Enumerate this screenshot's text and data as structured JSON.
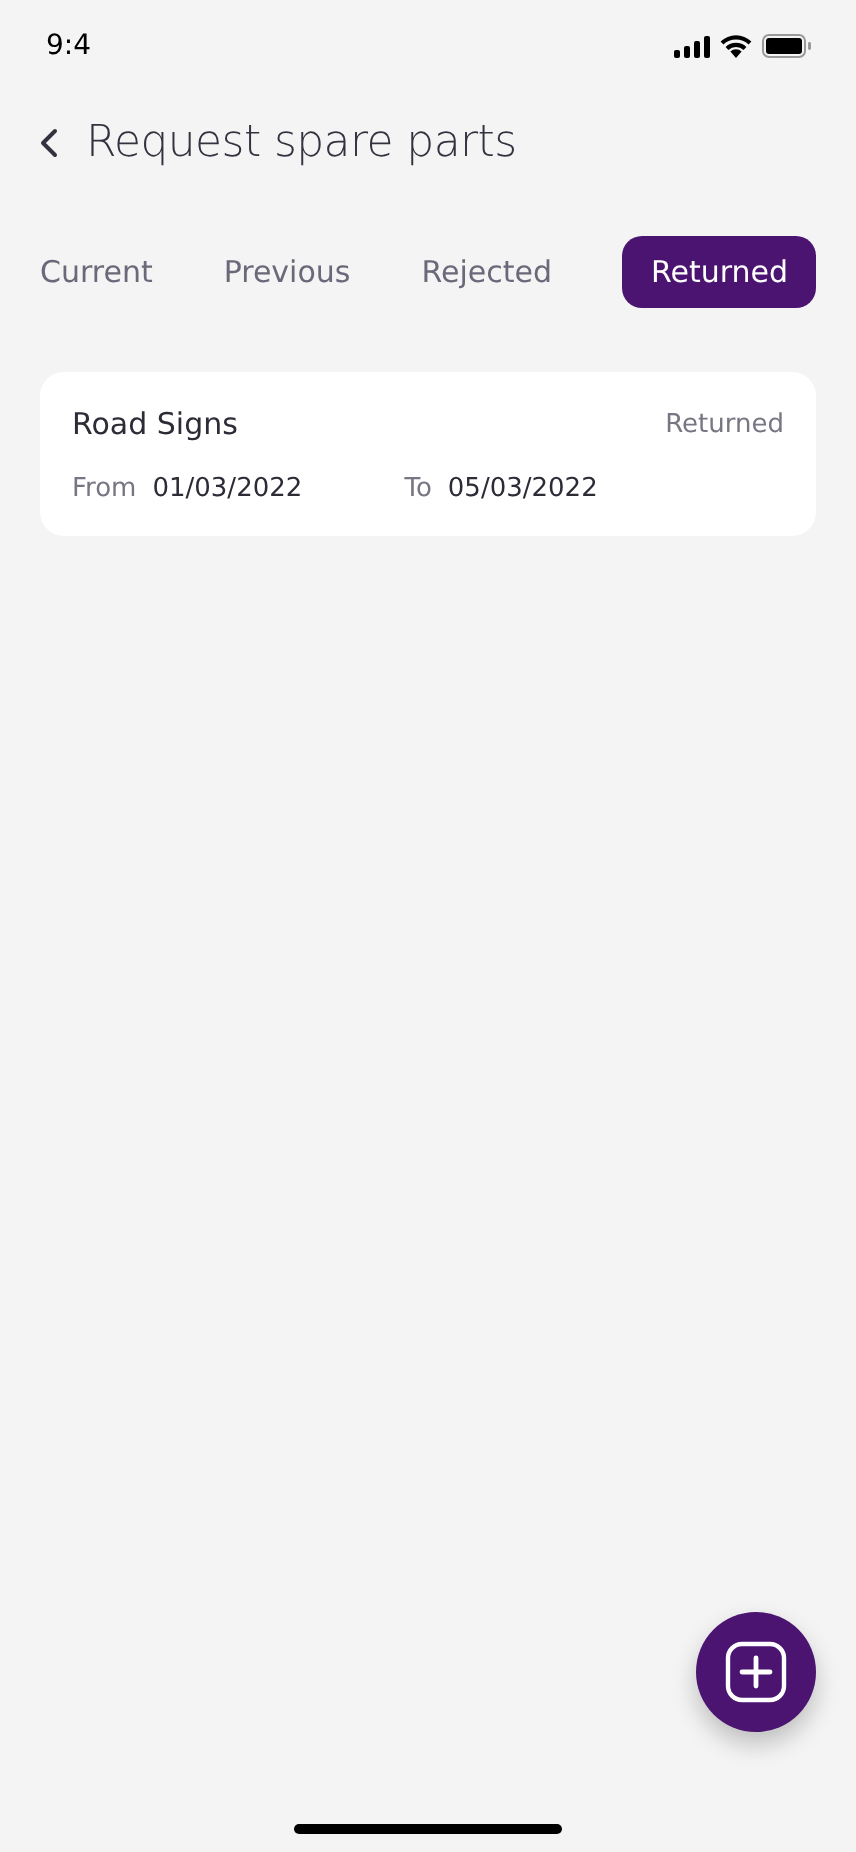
{
  "status_bar": {
    "time": "9:4"
  },
  "header": {
    "title": "Request spare parts"
  },
  "tabs": [
    {
      "label": "Current",
      "selected": false
    },
    {
      "label": "Previous",
      "selected": false
    },
    {
      "label": "Rejected",
      "selected": false
    },
    {
      "label": "Returned",
      "selected": true
    }
  ],
  "requests": [
    {
      "name": "Road Signs",
      "status": "Returned",
      "from_label": "From",
      "from": "01/03/2022",
      "to_label": "To",
      "to": "05/03/2022"
    }
  ]
}
